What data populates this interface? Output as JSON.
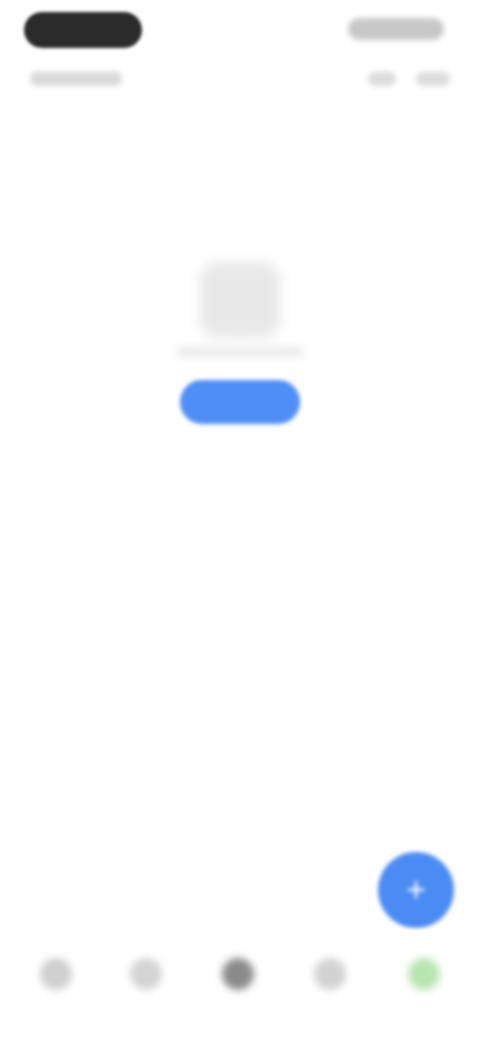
{
  "status_bar": {
    "time": "",
    "sub_left": ""
  },
  "empty_state": {
    "illustration_icon": "empty-box-icon",
    "button_label": ""
  },
  "fab": {
    "icon": "plus-icon",
    "label": "+"
  },
  "bottom_nav": {
    "items": [
      {
        "icon": "home-icon",
        "label": ""
      },
      {
        "icon": "search-icon",
        "label": ""
      },
      {
        "icon": "circle-icon",
        "label": ""
      },
      {
        "icon": "list-icon",
        "label": ""
      },
      {
        "icon": "profile-icon",
        "label": ""
      }
    ]
  },
  "colors": {
    "accent": "#4f8ef5",
    "fab": "#4a8cf4",
    "status_pill": "#2b2b2b",
    "nav_active": "#8a8a8a",
    "nav_highlight": "#b8e6b0"
  }
}
